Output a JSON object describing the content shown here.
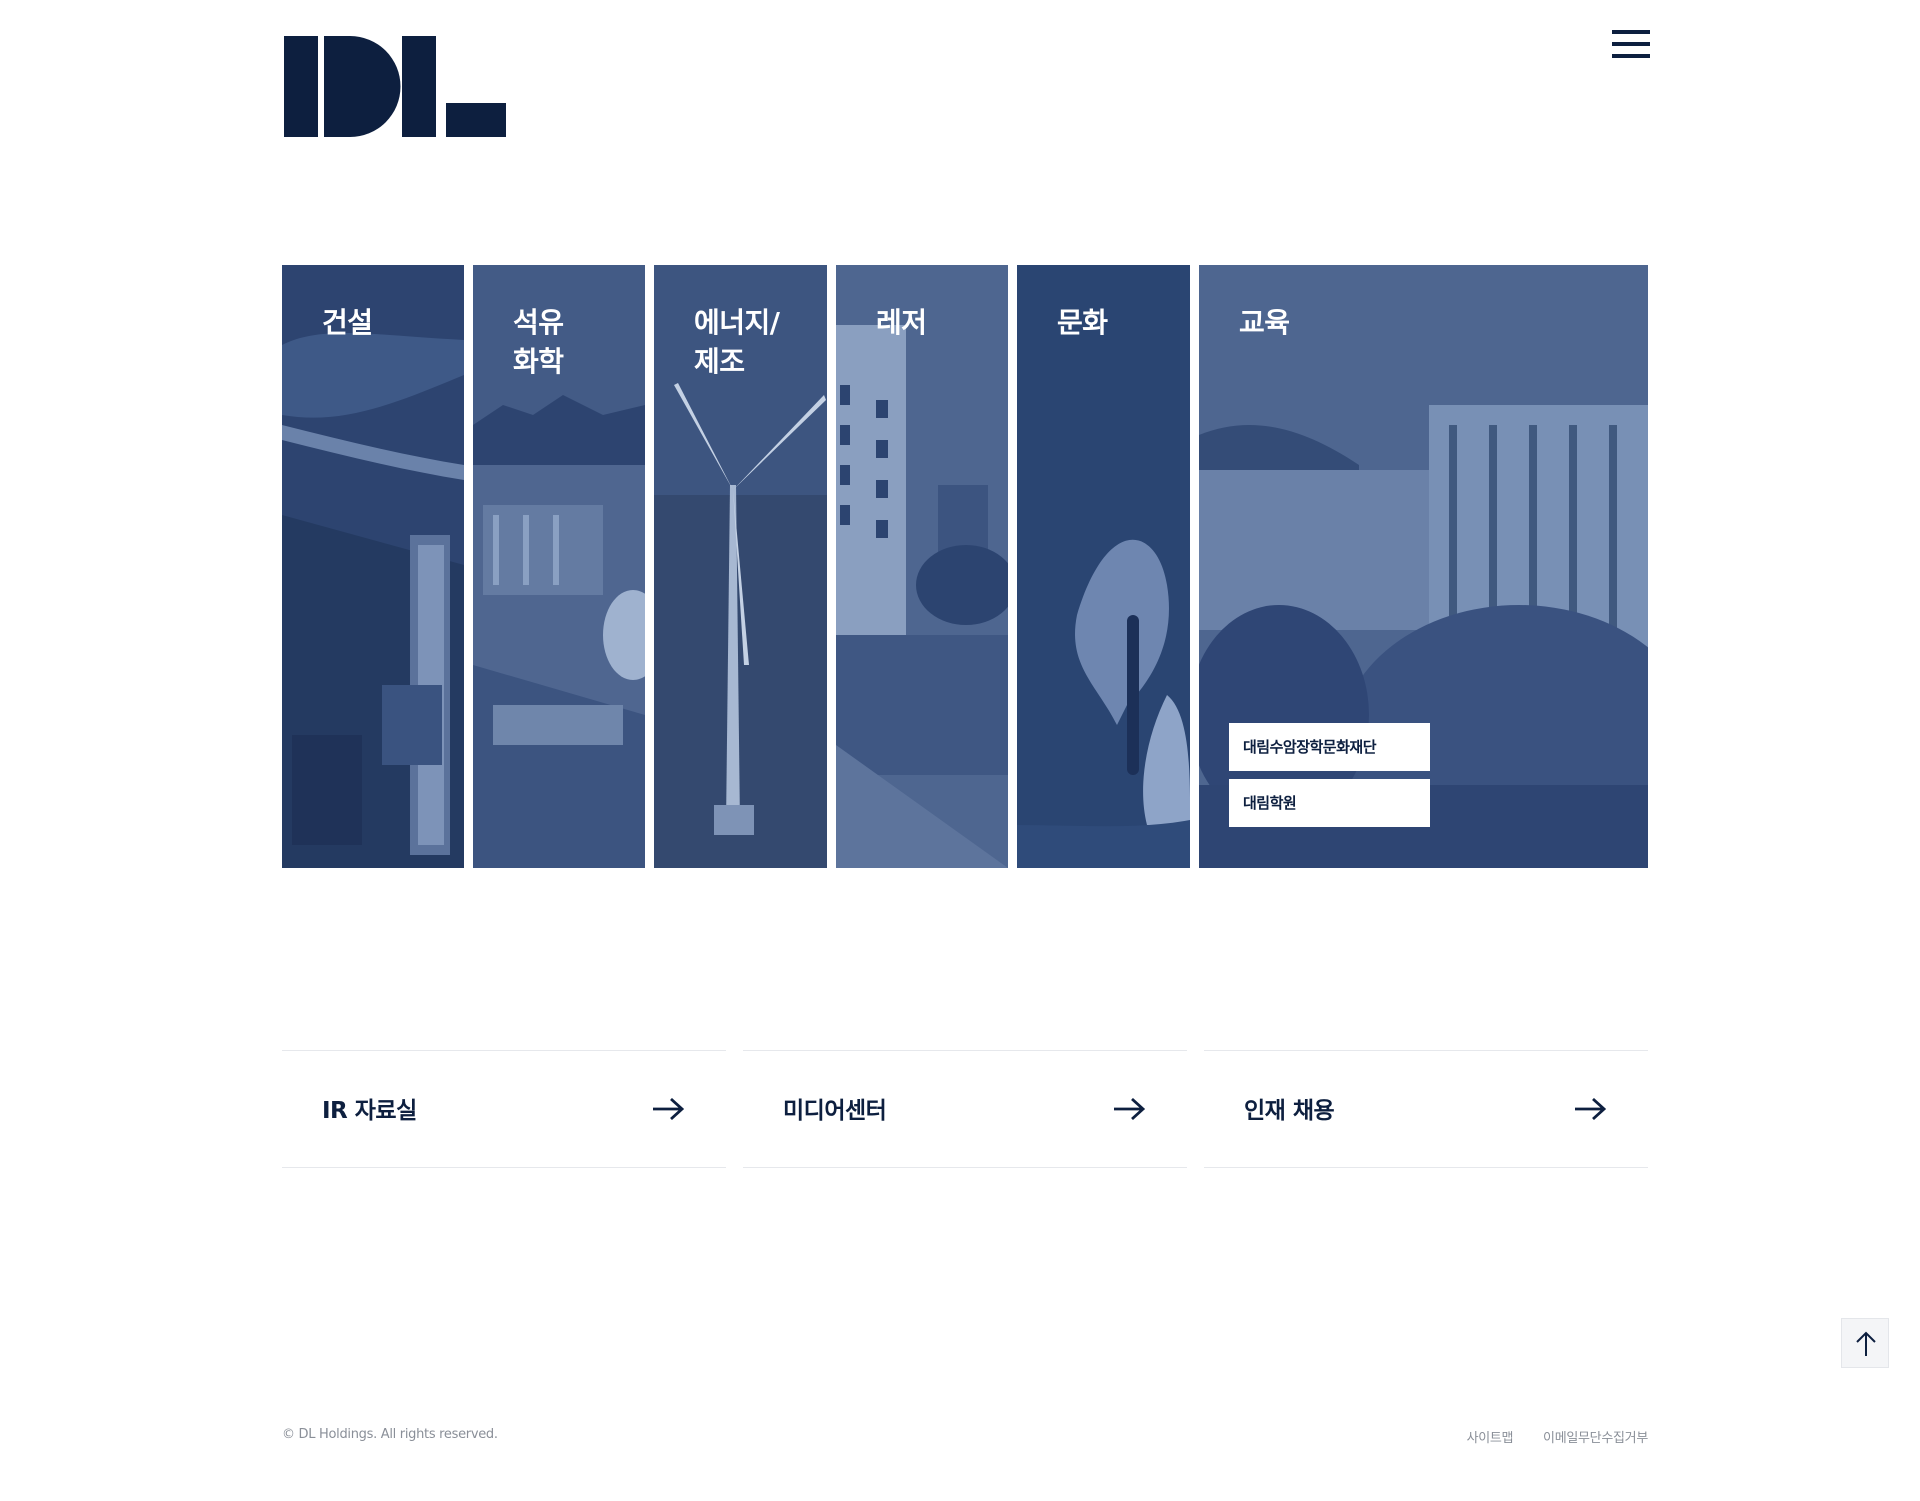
{
  "header": {
    "logo_text": "DL",
    "menu_icon": "hamburger-menu-icon"
  },
  "business_panels": [
    {
      "title": "건설"
    },
    {
      "title": "석유\n화학"
    },
    {
      "title": "에너지/\n제조"
    },
    {
      "title": "레저"
    },
    {
      "title": "문화"
    },
    {
      "title": "교육",
      "links": [
        "대림수암장학문화재단",
        "대림학원"
      ]
    }
  ],
  "quick_links": [
    {
      "label": "IR 자료실",
      "icon": "arrow-right-icon"
    },
    {
      "label": "미디어센터",
      "icon": "arrow-right-icon"
    },
    {
      "label": "인재 채용",
      "icon": "arrow-right-icon"
    }
  ],
  "scroll_top_icon": "arrow-up-icon",
  "footer": {
    "copyright": "© DL Holdings. All rights reserved.",
    "links": [
      "사이트맵",
      "이메일무단수집거부"
    ]
  },
  "colors": {
    "brand_navy": "#0d1f3f",
    "panel_overlay": "#2b4470",
    "panel_active": "#2a4572"
  }
}
